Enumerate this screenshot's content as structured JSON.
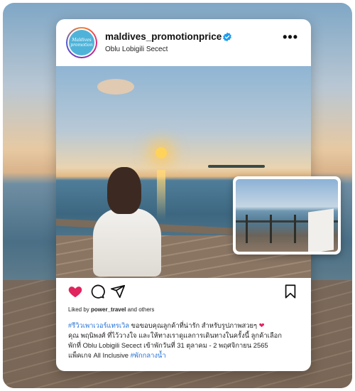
{
  "post": {
    "username": "maldives_promotionprice",
    "location": "Oblu Lobigili Secect",
    "avatar_text": [
      "Maldives",
      "promotion"
    ],
    "more_label": "•••",
    "liked_prefix": "Liked by",
    "liked_user": "power_travel",
    "liked_suffix": "and others",
    "caption": {
      "hashtag1": "#รีวิวเพาเวอร์แทรเวิล",
      "line1": " ขอขอบคุณลูกค้าที่น่ารัก สำหรับรูปภาพสวยๆ ",
      "line2": "คุณ พฤนิพงศ์ ที่ไว้วางใจ และให้ทางเราดูแลการเดินทางในครั้งนี้ ลูกค้าเลือก",
      "line3": "พักที่ Oblu Lobigili Secect เข้าพักวันที่ 31 ตุลาคม - 2 พฤศจิกายน 2565",
      "line4": "แพ็คเกจ All Inclusive ",
      "hashtag2": "#พักกลางน้ำ"
    }
  },
  "colors": {
    "accent_blue": "#1f6fd6",
    "like_red": "#e0245e",
    "verified_blue": "#1d9bf0"
  },
  "icons": [
    "heart-icon",
    "comment-icon",
    "share-icon",
    "bookmark-icon",
    "verified-icon",
    "more-icon"
  ]
}
